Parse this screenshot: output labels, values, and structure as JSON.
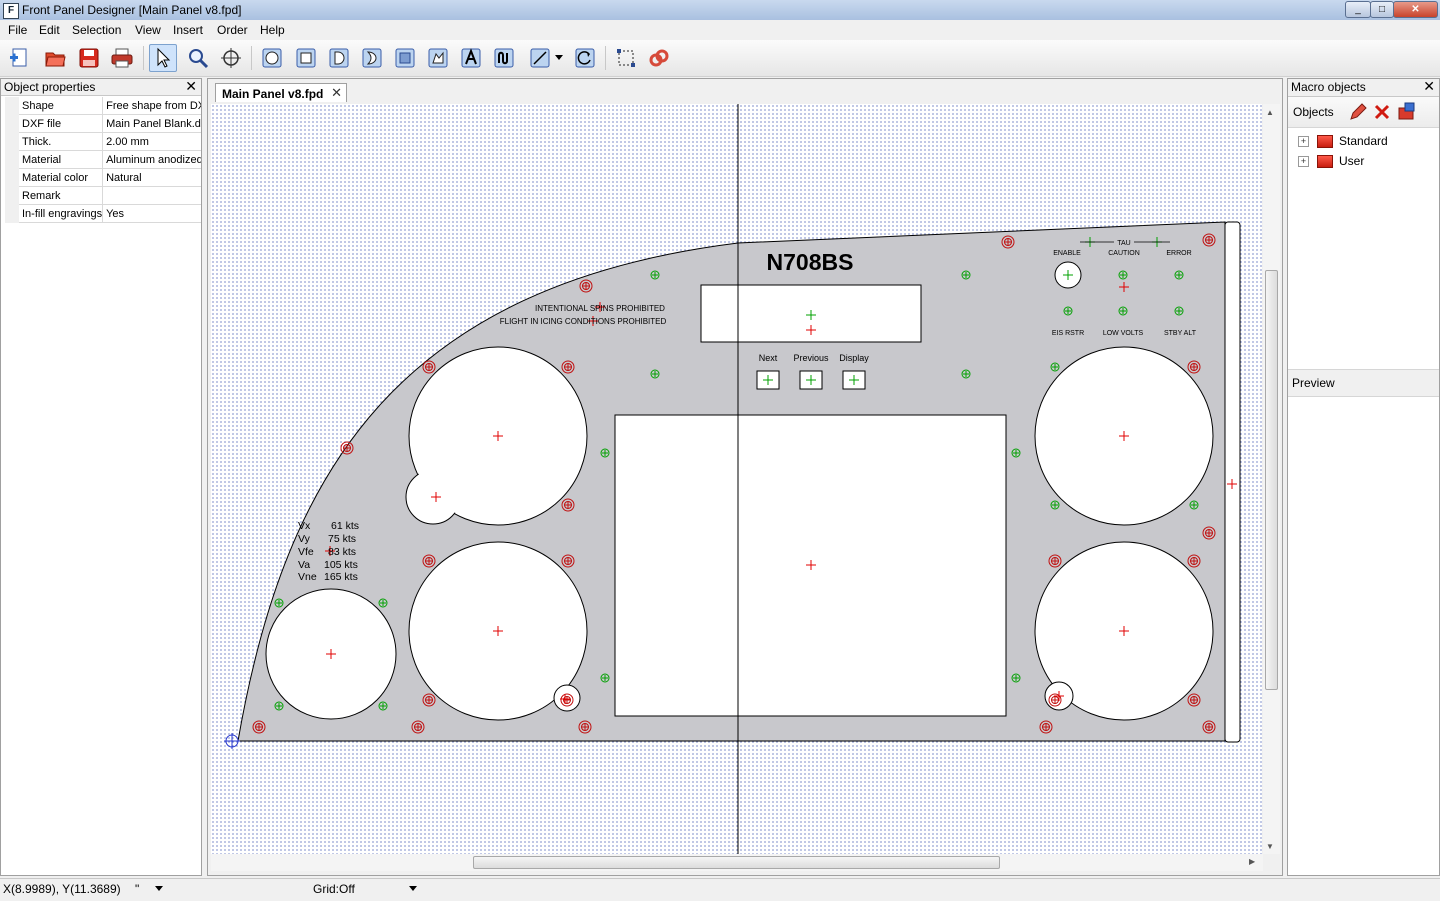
{
  "window": {
    "title": "Front Panel Designer [Main Panel v8.fpd]",
    "minimize": "_",
    "maximize": "□",
    "close": "✕"
  },
  "menu": [
    "File",
    "Edit",
    "Selection",
    "View",
    "Insert",
    "Order",
    "Help"
  ],
  "toolbar": {
    "icons": [
      "new-file-icon",
      "open-folder-icon",
      "save-icon",
      "print-icon",
      "select-arrow-icon",
      "zoom-icon",
      "crosshair-icon",
      "rect-round-hole-icon",
      "rect-square-hole-icon",
      "d-hole-icon",
      "double-d-hole-icon",
      "square-pocket-icon",
      "free-pocket-icon",
      "text-engraving-icon",
      "curve-text-icon",
      "line-tool-icon",
      "dropdown-arrow-icon",
      "rotate-icon",
      "bounding-box-icon",
      "link-icon"
    ]
  },
  "object_properties": {
    "title": "Object properties",
    "rows": [
      {
        "key": "Shape",
        "value": "Free shape from DX"
      },
      {
        "key": "DXF file",
        "value": "Main Panel Blank.dx"
      },
      {
        "key": "Thick.",
        "value": "2.00 mm"
      },
      {
        "key": "Material",
        "value": "Aluminum anodized"
      },
      {
        "key": "Material color",
        "value": "Natural"
      },
      {
        "key": "Remark",
        "value": ""
      },
      {
        "key": "In-fill engravings",
        "value": "Yes"
      }
    ]
  },
  "document": {
    "tab_label": "Main Panel v8.fpd",
    "panel": {
      "tail_number": "N708BS",
      "warning_line1": "INTENTIONAL SPINS PROHIBITED",
      "warning_line2": "FLIGHT IN ICING CONDITIONS PROHIBITED",
      "button_labels": [
        "Next",
        "Previous",
        "Display"
      ],
      "tau_label": "TAU",
      "annunciator_top": [
        "ENABLE",
        "CAUTION",
        "ERROR"
      ],
      "annunciator_bottom": [
        "EIS RSTR",
        "LOW VOLTS",
        "STBY ALT"
      ],
      "speeds": [
        {
          "label": "Vx",
          "value": "61 kts"
        },
        {
          "label": "Vy",
          "value": "75 kts"
        },
        {
          "label": "Vfe",
          "value": "83 kts"
        },
        {
          "label": "Va",
          "value": "105 kts"
        },
        {
          "label": "Vne",
          "value": "165 kts"
        }
      ]
    }
  },
  "macro_objects": {
    "title": "Macro objects",
    "objects_label": "Objects",
    "tree": [
      "Standard",
      "User"
    ],
    "preview_label": "Preview"
  },
  "statusbar": {
    "coords": "X(8.9989), Y(11.3689)",
    "unit": "\"",
    "grid": "Grid:Off"
  },
  "colors": {
    "panel_fill": "#c8c8cc",
    "grid_dot": "#6f7fc4",
    "green_marker": "#00a000",
    "red_marker": "#e00000"
  }
}
